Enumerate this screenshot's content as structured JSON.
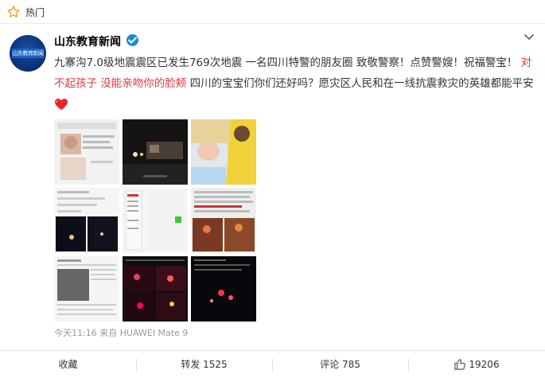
{
  "hotbar": {
    "label": "热门"
  },
  "post": {
    "username": "山东教育新闻",
    "avatar_text": "山东教育新闻",
    "text_part1": "九寨沟7.0级地震震区已发生769次地震 一名四川特警的朋友圈 致敬警察！点赞警嫂！祝福警宝！",
    "text_red": "对不起孩子 没能亲吻你的脸颊",
    "text_part2": " 四川的宝宝们你们还好吗？愿灾区人民和在一线抗震救灾的英雄都能平安",
    "meta": "今天11:16 来自 HUAWEI Mate 9"
  },
  "actions": {
    "favorite": "收藏",
    "repost": "转发 1525",
    "comment": "评论 785",
    "like": "19206"
  },
  "colors": {
    "accent_red": "#e03838",
    "verified_blue": "#1b8ad8",
    "like_orange": "#f0a020"
  }
}
